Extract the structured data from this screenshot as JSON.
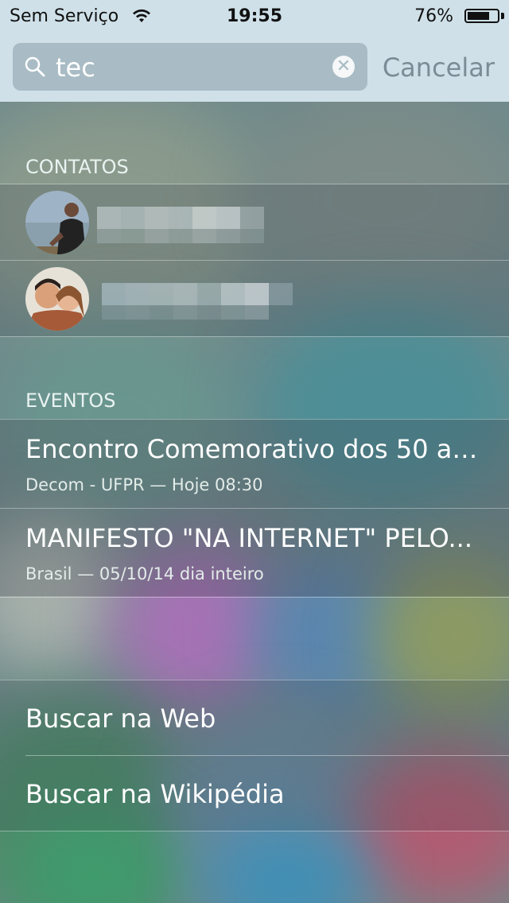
{
  "status_bar": {
    "carrier": "Sem Serviço",
    "time": "19:55",
    "battery": "76%",
    "battery_level": 0.76
  },
  "search": {
    "value": "tec",
    "cancel_label": "Cancelar"
  },
  "contacts": {
    "header": "CONTATOS",
    "items": [
      {
        "avatar": "person-photo-1"
      },
      {
        "avatar": "couple-photo"
      }
    ]
  },
  "events": {
    "header": "EVENTOS",
    "items": [
      {
        "title": "Encontro Comemorativo dos 50 anos de...",
        "subtitle": "Decom - UFPR — Hoje 08:30"
      },
      {
        "title": "MANIFESTO \"NA INTERNET\" PELO...",
        "subtitle": "Brasil — 05/10/14 dia inteiro"
      }
    ]
  },
  "actions": [
    {
      "label": "Buscar na Web"
    },
    {
      "label": "Buscar na Wikipédia"
    }
  ],
  "colors": {
    "header_bg": "#cfe0e8",
    "search_field": "#a9bcc5",
    "text_light": "#ffffff"
  }
}
